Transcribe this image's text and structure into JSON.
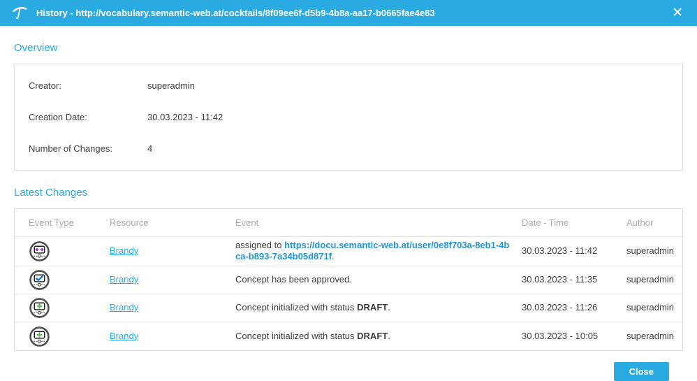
{
  "header": {
    "title": "History - http://vocabulary.semantic-web.at/cocktails/8f09ee6f-d5b9-4b8a-aa17-b0665fae4e83",
    "close_icon": "✕",
    "logo_icon": "cocktail-umbrella-logo"
  },
  "overview": {
    "heading": "Overview",
    "fields": [
      {
        "label": "Creator:",
        "value": "superadmin"
      },
      {
        "label": "Creation Date:",
        "value": "30.03.2023 - 11:42"
      },
      {
        "label": "Number of Changes:",
        "value": "4"
      }
    ]
  },
  "latest_changes": {
    "heading": "Latest Changes",
    "columns": {
      "event_type": "Event Type",
      "resource": "Resource",
      "event": "Event",
      "date_time": "Date - Time",
      "author": "Author"
    },
    "rows": [
      {
        "event_type_icon": "concept-assigned-user-icon",
        "resource": "Brandy",
        "event_prefix": "assigned to ",
        "event_link": "https://docu.semantic-web.at/user/0e8f703a-8eb1-4bca-b893-7a34b05d871f",
        "event_suffix": ".",
        "date_time": "30.03.2023 - 11:42",
        "author": "superadmin"
      },
      {
        "event_type_icon": "concept-approved-icon",
        "resource": "Brandy",
        "event_prefix": "Concept has been approved.",
        "date_time": "30.03.2023 - 11:35",
        "author": "superadmin"
      },
      {
        "event_type_icon": "concept-initialized-icon",
        "resource": "Brandy",
        "event_prefix": "Concept initialized with status ",
        "event_bold": "DRAFT",
        "event_suffix": ".",
        "date_time": "30.03.2023 - 11:26",
        "author": "superadmin"
      },
      {
        "event_type_icon": "concept-initialized-icon",
        "resource": "Brandy",
        "event_prefix": "Concept initialized with status ",
        "event_bold": "DRAFT",
        "event_suffix": ".",
        "date_time": "30.03.2023 - 10:05",
        "author": "superadmin"
      }
    ]
  },
  "footer": {
    "close_label": "Close"
  },
  "colors": {
    "accent": "#29abe2",
    "event_link": "#2196d3",
    "icon_assigned_symbol": "#9b30d9",
    "icon_approved_symbol": "#1976d2",
    "icon_initialized_symbol": "#5cb85c",
    "table_header_text": "#aaaaaa"
  }
}
